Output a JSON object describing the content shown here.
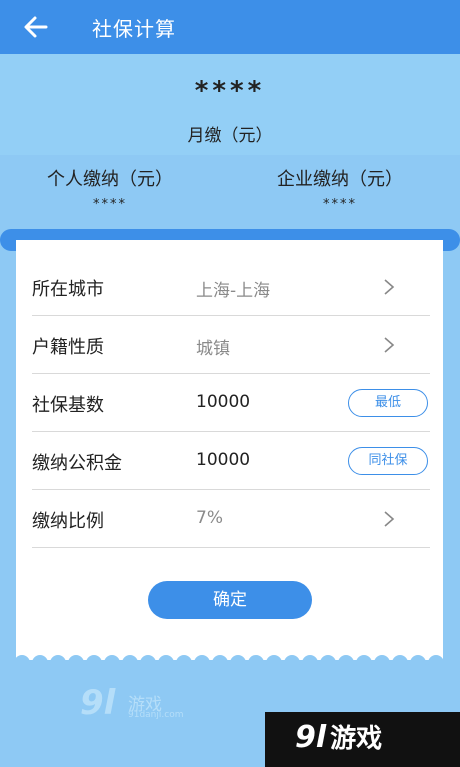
{
  "appbar": {
    "title": "社保计算",
    "back_icon": "arrow-left-icon",
    "color": "#3d8fe8"
  },
  "summary": {
    "monthly_amount": "****",
    "monthly_label": "月缴（元）",
    "personal_label": "个人缴纳（元）",
    "personal_value": "****",
    "company_label": "企业缴纳（元）",
    "company_value": "****"
  },
  "form": {
    "rows": [
      {
        "label": "所在城市",
        "value": "上海-上海",
        "icon": "chevron-right-icon"
      },
      {
        "label": "户籍性质",
        "value": "城镇",
        "icon": "chevron-right-icon"
      },
      {
        "label": "社保基数",
        "value": "10000",
        "button": "最低"
      },
      {
        "label": "缴纳公积金",
        "value": "10000",
        "button": "同社保"
      },
      {
        "label": "缴纳比例",
        "value": "7%",
        "icon": "chevron-right-icon"
      }
    ],
    "confirm_label": "确定"
  },
  "watermark": {
    "logo_number": "9l",
    "logo_text": "游戏",
    "url": "91danji.com"
  },
  "corner_logo": {
    "number": "9l",
    "text": "游戏"
  },
  "colors": {
    "accent": "#3d8fe8",
    "background": "#8ec9f4",
    "card": "#ffffff"
  }
}
